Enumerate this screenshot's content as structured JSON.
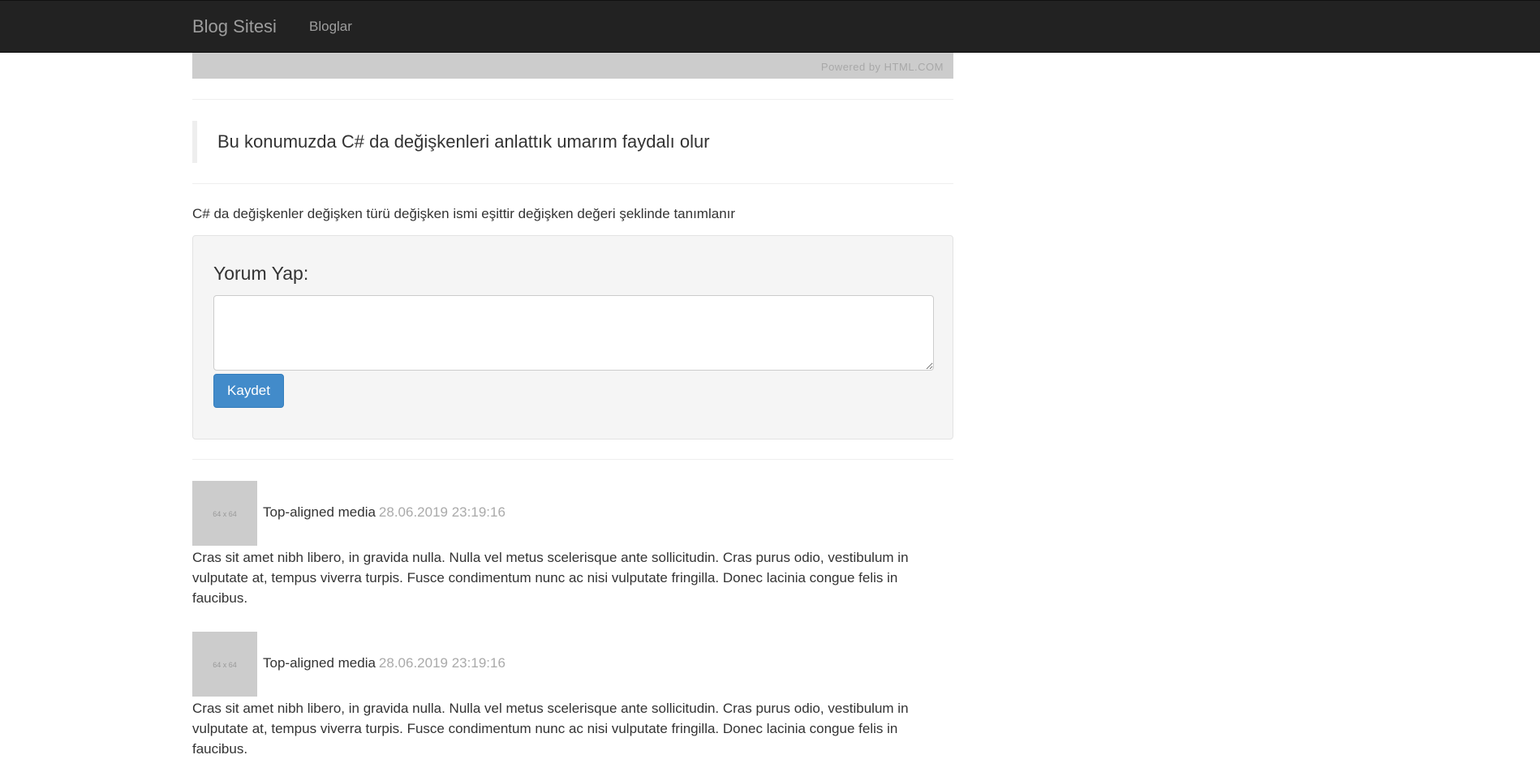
{
  "navbar": {
    "brand": "Blog Sitesi",
    "links": [
      "Bloglar"
    ]
  },
  "header_image": {
    "credit": "Powered by HTML.COM"
  },
  "post": {
    "quote": "Bu konumuzda C# da değişkenleri anlattık umarım faydalı olur",
    "body": "C# da değişkenler değişken türü değişken ismi eşittir değişken değeri şeklinde tanımlanır"
  },
  "comment_form": {
    "title": "Yorum Yap:",
    "textarea_value": "",
    "submit_label": "Kaydet"
  },
  "comments": [
    {
      "thumb_label": "64 x 64",
      "heading": "Top-aligned media",
      "time": "28.06.2019 23:19:16",
      "text": "Cras sit amet nibh libero, in gravida nulla. Nulla vel metus scelerisque ante sollicitudin. Cras purus odio, vestibulum in vulputate at, tempus viverra turpis. Fusce condimentum nunc ac nisi vulputate fringilla. Donec lacinia congue felis in faucibus."
    },
    {
      "thumb_label": "64 x 64",
      "heading": "Top-aligned media",
      "time": "28.06.2019 23:19:16",
      "text": "Cras sit amet nibh libero, in gravida nulla. Nulla vel metus scelerisque ante sollicitudin. Cras purus odio, vestibulum in vulputate at, tempus viverra turpis. Fusce condimentum nunc ac nisi vulputate fringilla. Donec lacinia congue felis in faucibus."
    }
  ],
  "colors": {
    "navbar_bg": "#222222",
    "nav_text": "#9d9d9d",
    "primary": "#428bca",
    "well_bg": "#f5f5f5",
    "muted_time": "#aaaaaa"
  }
}
